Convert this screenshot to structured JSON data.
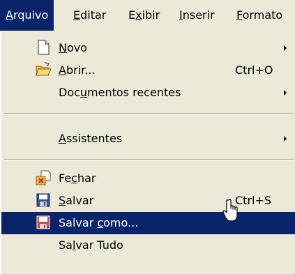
{
  "menubar": {
    "items": [
      {
        "pre": "",
        "u": "A",
        "post": "rquivo"
      },
      {
        "pre": "",
        "u": "E",
        "post": "ditar"
      },
      {
        "pre": "E",
        "u": "x",
        "post": "ibir"
      },
      {
        "pre": "",
        "u": "I",
        "post": "nserir"
      },
      {
        "pre": "",
        "u": "F",
        "post": "ormato"
      }
    ]
  },
  "menu": {
    "items": [
      {
        "pre": "",
        "u": "N",
        "post": "ovo",
        "shortcut": "",
        "icon": "new-document-icon",
        "submenu": true
      },
      {
        "pre": "",
        "u": "A",
        "post": "brir...",
        "shortcut": "Ctrl+O",
        "icon": "open-folder-icon",
        "submenu": false
      },
      {
        "pre": "Doc",
        "u": "u",
        "post": "mentos recentes",
        "shortcut": "",
        "icon": "",
        "submenu": true
      },
      {
        "pre": "",
        "u": "A",
        "post": "ssistentes",
        "shortcut": "",
        "icon": "",
        "submenu": true
      },
      {
        "pre": "Fe",
        "u": "c",
        "post": "har",
        "shortcut": "",
        "icon": "close-document-icon",
        "submenu": false
      },
      {
        "pre": "",
        "u": "S",
        "post": "alvar",
        "shortcut": "Ctrl+S",
        "icon": "save-icon",
        "submenu": false
      },
      {
        "pre": "Salvar ",
        "u": "c",
        "post": "omo...",
        "shortcut": "",
        "icon": "save-as-icon",
        "submenu": false,
        "selected": true
      },
      {
        "pre": "Sa",
        "u": "l",
        "post": "var Tudo",
        "shortcut": "",
        "icon": "",
        "submenu": false
      }
    ]
  },
  "colors": {
    "menu_bg": "#ece9d8",
    "highlight": "#0a246a",
    "highlight_text": "#ffffff"
  }
}
